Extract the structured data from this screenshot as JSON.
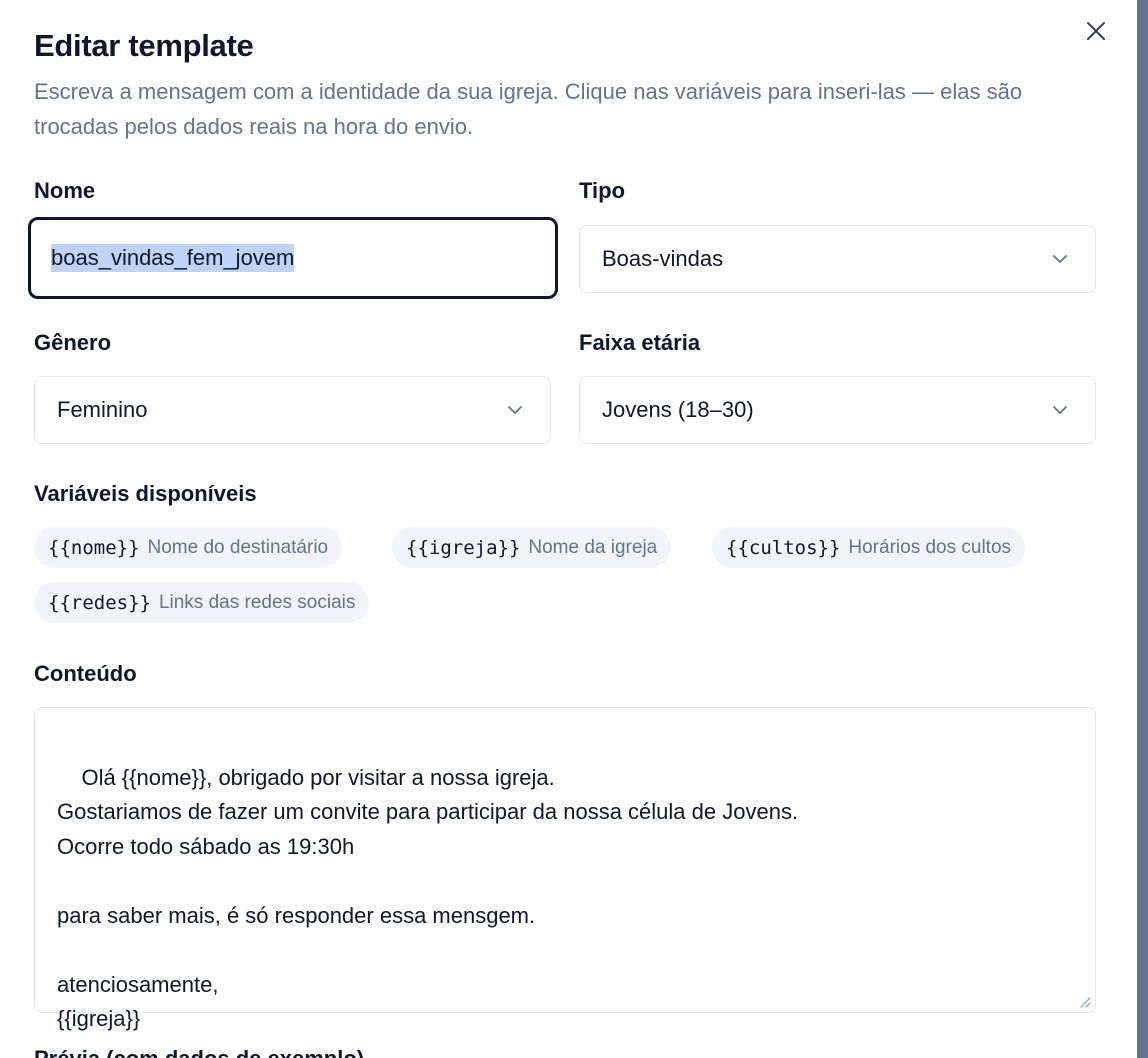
{
  "dialog": {
    "title": "Editar template",
    "description": "Escreva a mensagem com a identidade da sua igreja. Clique nas variáveis para inseri-las — elas são trocadas pelos dados reais na hora do envio.",
    "close_icon": "close-icon"
  },
  "form": {
    "nome_label": "Nome",
    "nome_value": "boas_vindas_fem_jovem",
    "tipo_label": "Tipo",
    "tipo_value": "Boas-vindas",
    "genero_label": "Gênero",
    "genero_value": "Feminino",
    "faixa_label": "Faixa etária",
    "faixa_value": "Jovens (18–30)"
  },
  "variables": {
    "label": "Variáveis disponíveis",
    "items": [
      {
        "code": "{{nome}}",
        "hint": "Nome do destinatário"
      },
      {
        "code": "{{igreja}}",
        "hint": "Nome da igreja"
      },
      {
        "code": "{{cultos}}",
        "hint": "Horários dos cultos"
      },
      {
        "code": "{{redes}}",
        "hint": "Links das redes sociais"
      }
    ]
  },
  "content": {
    "label": "Conteúdo",
    "value": "Olá {{nome}}, obrigado por visitar a nossa igreja.\nGostariamos de fazer um convite para participar da nossa célula de Jovens.\nOcorre todo sábado as 19:30h\n\npara saber mais, é só responder essa mensgem.\n\natenciosamente,\n{{igreja}}"
  },
  "preview": {
    "label": "Prévia (com dados de exemplo)"
  },
  "colors": {
    "text": "#0f172a",
    "muted": "#64748b",
    "border": "#e2e8f0",
    "chip_bg": "#f1f5f9",
    "selection": "#bfd3f6"
  }
}
